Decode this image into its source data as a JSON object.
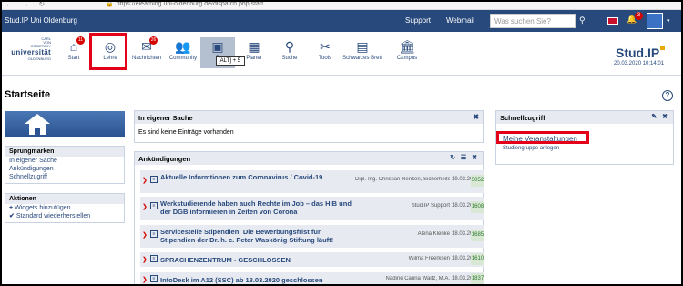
{
  "browser": {
    "url": "https://elearning.uni-oldenburg.de/dispatch.php/start",
    "nav": "← → ↻"
  },
  "topbar": {
    "site": "Stud.IP Uni Oldenburg",
    "support": "Support",
    "webmail": "Webmail",
    "search_placeholder": "Was suchen Sie?",
    "notification_count": "3"
  },
  "uni_logo": {
    "line1": "CARL",
    "line2": "VON",
    "line3": "OSSIETZKY",
    "big": "universität",
    "tiny": "OLDENBURG"
  },
  "nav": [
    {
      "label": "Start",
      "icon": "home-icon",
      "glyph": "⌂",
      "badge": "11"
    },
    {
      "label": "Lehre",
      "icon": "lehre-icon",
      "glyph": "◎",
      "badge": ""
    },
    {
      "label": "Nachrichten",
      "icon": "mail-icon",
      "glyph": "✉",
      "badge": "26"
    },
    {
      "label": "Community",
      "icon": "community-icon",
      "glyph": "👥",
      "badge": ""
    },
    {
      "label": "P",
      "icon": "profile-icon",
      "glyph": "▣",
      "badge": ""
    },
    {
      "label": "Planer",
      "icon": "planer-icon",
      "glyph": "▦",
      "badge": ""
    },
    {
      "label": "Suche",
      "icon": "search-icon",
      "glyph": "⚲",
      "badge": ""
    },
    {
      "label": "Tools",
      "icon": "tools-icon",
      "glyph": "✂",
      "badge": ""
    },
    {
      "label": "Schwarzes Brett",
      "icon": "board-icon",
      "glyph": "▤",
      "badge": ""
    },
    {
      "label": "Campus",
      "icon": "campus-icon",
      "glyph": "🏛",
      "badge": ""
    }
  ],
  "tooltip": "[ALT] + 5",
  "brand": {
    "name": "Stud.IP",
    "datetime": "20.03.2020 10:14:01"
  },
  "page_title": "Startseite",
  "sidebar": {
    "sprung_title": "Sprungmarken",
    "sprung_items": [
      "In eigener Sache",
      "Ankündigungen",
      "Schnellzugriff"
    ],
    "aktionen_title": "Aktionen",
    "aktionen_items": [
      {
        "pfx": "+",
        "label": "Widgets hinzufügen"
      },
      {
        "pfx": "✔",
        "label": "Standard wiederherstellen"
      }
    ]
  },
  "eigene_sache": {
    "title": "In eigener Sache",
    "text": "Es sind keine Einträge vorhanden"
  },
  "ankuendigungen": {
    "title": "Ankündigungen",
    "rows": [
      {
        "title": "Aktuelle Informtionen zum Coronavirus / Covid-19",
        "author": "Dipl.-Ing. Christian Renken, Sicherheitsingenieur",
        "date": "19.03.2020",
        "count": "5052"
      },
      {
        "title": "Werkstudierende haben auch Rechte im Job – das HIB und der DGB informieren in Zeiten von Corona",
        "author": "Stud.IP Support",
        "date": "18.03.2020",
        "count": "1608"
      },
      {
        "title": "Servicestelle Stipendien: Die Bewerbungsfrist für Stipendien der Dr. h. c. Peter Waskönig Stiftung läuft!",
        "author": "Alena Klenke",
        "date": "18.03.2020",
        "count": "1685"
      },
      {
        "title": "SPRACHENZENTRUM - GESCHLOSSEN",
        "author": "Wilma Freerksen",
        "date": "18.03.2020",
        "count": "1610"
      },
      {
        "title": "InfoDesk im A12 (SSC) ab 18.03.2020 geschlossen",
        "author": "Nadine Carina Waitz, M.A.",
        "date": "18.03.2020",
        "count": "1837"
      }
    ]
  },
  "schnellzugriff": {
    "title": "Schnellzugriff",
    "link1": "Meine Veranstaltungen",
    "link2": "Studiengruppe anlegen"
  }
}
